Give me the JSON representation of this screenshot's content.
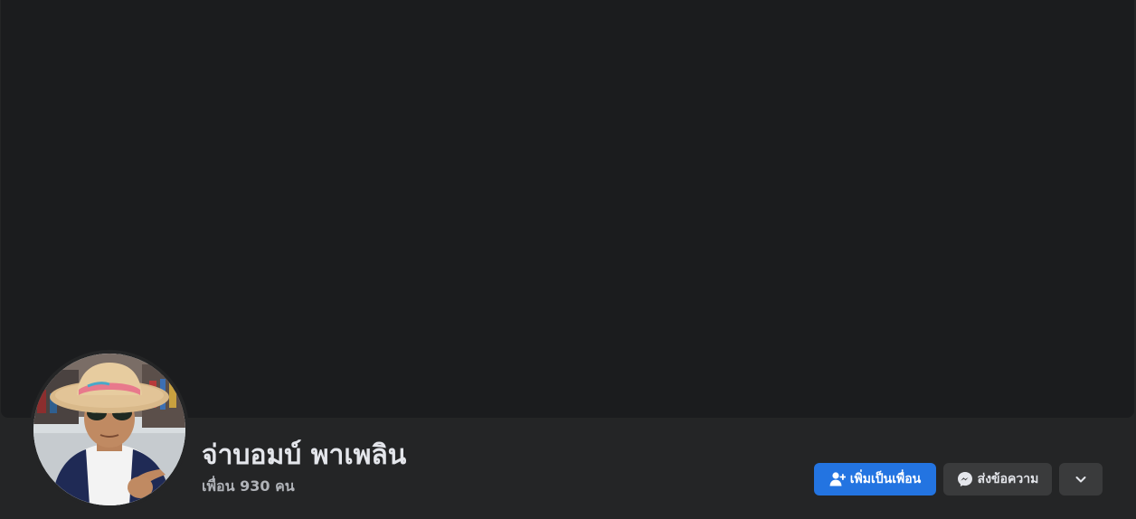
{
  "profile": {
    "name": "จ่าบอมบ์ พาเพลิน",
    "friends_text": "เพื่อน 930 คน"
  },
  "actions": {
    "add_friend_label": "เพิ่มเป็นเพื่อน",
    "message_label": "ส่งข้อความ"
  },
  "icons": {
    "add_friend": "add-friend-icon",
    "messenger": "messenger-icon",
    "more": "chevron-down-icon"
  },
  "colors": {
    "primary_button": "#2374e1",
    "secondary_button": "#3a3b3c",
    "cover": "#1b1c1e",
    "background": "#242526"
  }
}
